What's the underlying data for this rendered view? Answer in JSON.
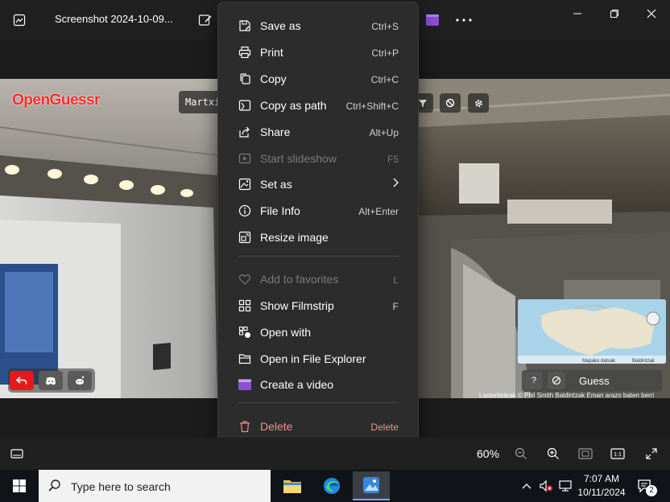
{
  "window": {
    "title": "Screenshot 2024-10-09..."
  },
  "game": {
    "logo": "OpenGuessr",
    "player": "Martxi",
    "guess_label": "Guess",
    "help_label": "?",
    "credits": "Lasterbideak  © Phil Smith  Baldintzak  Eman arazo baten berri",
    "map_labels": {
      "shortcuts": "Mapako datuak",
      "terms": "Baldintzak"
    }
  },
  "context_menu": {
    "items": [
      {
        "label": "Save as",
        "shortcut": "Ctrl+S",
        "icon": "save-as-icon",
        "disabled": false
      },
      {
        "label": "Print",
        "shortcut": "Ctrl+P",
        "icon": "print-icon",
        "disabled": false
      },
      {
        "label": "Copy",
        "shortcut": "Ctrl+C",
        "icon": "copy-icon",
        "disabled": false
      },
      {
        "label": "Copy as path",
        "shortcut": "Ctrl+Shift+C",
        "icon": "copy-path-icon",
        "disabled": false
      },
      {
        "label": "Share",
        "shortcut": "Alt+Up",
        "icon": "share-icon",
        "disabled": false
      },
      {
        "label": "Start slideshow",
        "shortcut": "F5",
        "icon": "slideshow-icon",
        "disabled": true
      },
      {
        "label": "Set as",
        "shortcut": "",
        "icon": "set-as-icon",
        "disabled": false,
        "submenu": true
      },
      {
        "label": "File Info",
        "shortcut": "Alt+Enter",
        "icon": "info-icon",
        "disabled": false
      },
      {
        "label": "Resize image",
        "shortcut": "",
        "icon": "resize-icon",
        "disabled": false
      },
      {
        "label": "Add to favorites",
        "shortcut": "L",
        "icon": "heart-icon",
        "disabled": true
      },
      {
        "label": "Show Filmstrip",
        "shortcut": "F",
        "icon": "filmstrip-icon",
        "disabled": false
      },
      {
        "label": "Open with",
        "shortcut": "",
        "icon": "open-with-icon",
        "disabled": false
      },
      {
        "label": "Open in File Explorer",
        "shortcut": "",
        "icon": "folder-icon",
        "disabled": false
      },
      {
        "label": "Create a video",
        "shortcut": "",
        "icon": "video-icon",
        "disabled": false
      },
      {
        "label": "Delete",
        "shortcut": "Delete",
        "icon": "trash-icon",
        "disabled": false,
        "danger": true
      }
    ]
  },
  "viewer": {
    "zoom": "60%"
  },
  "taskbar": {
    "search_placeholder": "Type here to search",
    "time": "7:07 AM",
    "date": "10/11/2024",
    "notification_count": "2"
  },
  "colors": {
    "menu_bg": "#2c2c2c",
    "danger": "#f08f8f",
    "opengussr_red": "#ff2d2d",
    "taskbar_bg": "#101418"
  }
}
